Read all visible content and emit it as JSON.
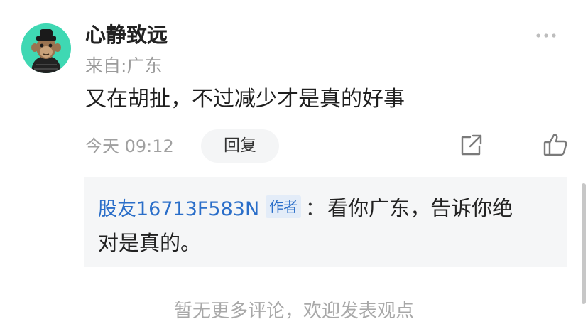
{
  "comment": {
    "user": {
      "name": "心静致远",
      "location": "来自:广东",
      "avatar_color": "#3fd8b3"
    },
    "text": "又在胡扯，不过减少才是真的好事",
    "time": "今天 09:12",
    "reply_label": "回复",
    "icons": [
      "more-icon",
      "share-icon",
      "thumbs-up-icon"
    ]
  },
  "reply": {
    "author": "股友16713F583N",
    "badge": "作者",
    "colon": "：",
    "text_line1": "看你广东，告诉你绝",
    "text_line2": "对是真的。"
  },
  "footer": {
    "note": "暂无更多评论，欢迎发表观点"
  },
  "colors": {
    "link_blue": "#2a6ec9",
    "badge_bg": "#e3ecf8",
    "reply_bg": "#f5f6f7",
    "muted_text": "#9b9b9b"
  }
}
